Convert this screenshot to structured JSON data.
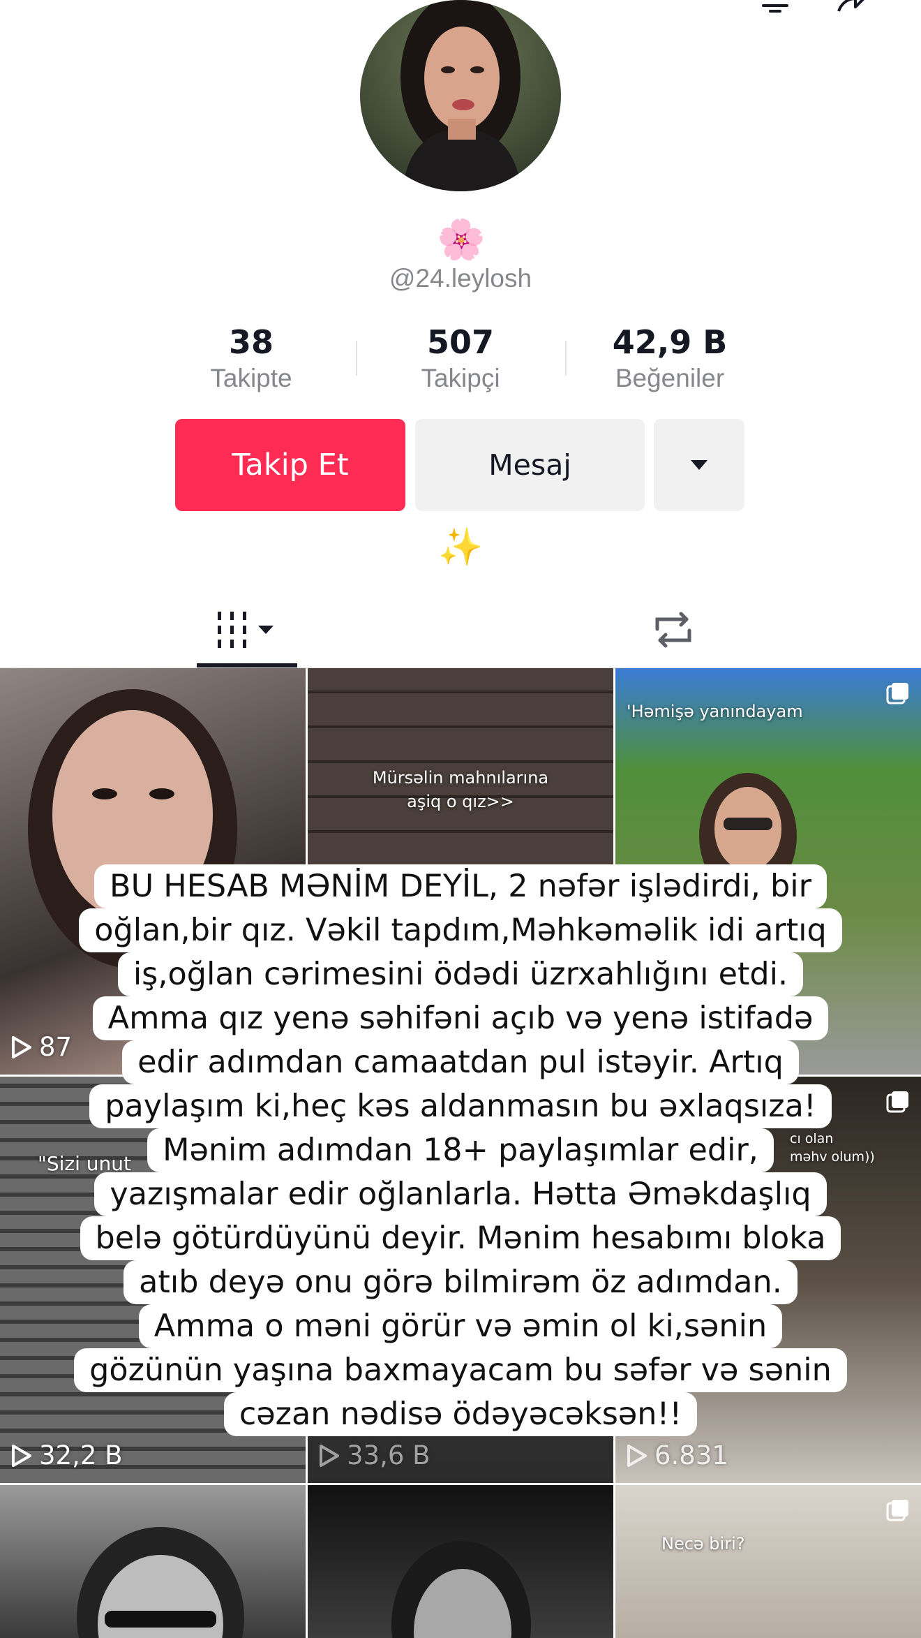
{
  "profile": {
    "emoji": "🌸",
    "username": "@24.leylosh",
    "bio_emoji": "✨"
  },
  "stats": [
    {
      "value": "38",
      "label": "Takipte"
    },
    {
      "value": "507",
      "label": "Takipçi"
    },
    {
      "value": "42,9 B",
      "label": "Beğeniler"
    }
  ],
  "actions": {
    "follow_label": "Takip Et",
    "message_label": "Mesaj"
  },
  "tabs": {
    "videos_icon": "grid-icon",
    "reposts_icon": "repost-icon"
  },
  "grid": [
    {
      "views": "87",
      "caption": ""
    },
    {
      "views": "",
      "caption": "Mürsəlin mahnılarına\naşiq o qız>>"
    },
    {
      "views": "",
      "caption": "'Həmişə yanındayam"
    },
    {
      "views": "",
      "caption": "\"Sizi unut"
    },
    {
      "views": "",
      "caption": ""
    },
    {
      "views": "",
      "caption": "cı olan\nməhv olum))"
    },
    {
      "views": "32,2 B",
      "caption": ""
    },
    {
      "views": "33,6 B",
      "caption": ""
    },
    {
      "views": "6.831",
      "caption": ""
    },
    {
      "views": "",
      "caption": ""
    },
    {
      "views": "",
      "caption": ""
    },
    {
      "views": "",
      "caption": "Necə biri?"
    }
  ],
  "overlay_lines": [
    "BU HESAB MƏNİM DEYİL, 2 nəfər işlədirdi, bir",
    "oğlan,bir qız. Vəkil tapdım,Məhkəməlik idi artıq",
    "iş,oğlan cərimesini ödədi üzrxahlığını etdi.",
    "Amma qız yenə səhifəni açıb və yenə istifadə",
    "edir adımdan camaatdan pul istəyir. Artıq",
    "paylaşım ki,heç kəs aldanmasın bu əxlaqsıza!",
    "Mənim adımdan 18+ paylaşımlar edir,",
    "yazışmalar edir oğlanlarla. Hətta Əməkdaşlıq",
    "belə götürdüyünü deyir. Mənim hesabımı bloka",
    "atıb deyə onu görə bilmirəm öz adımdan.",
    "Amma o məni görür və əmin ol ki,sənin",
    "gözünün yaşına baxmayacam bu səfər və sənin",
    "cəzan nədisə ödəyəcəksən!!"
  ]
}
